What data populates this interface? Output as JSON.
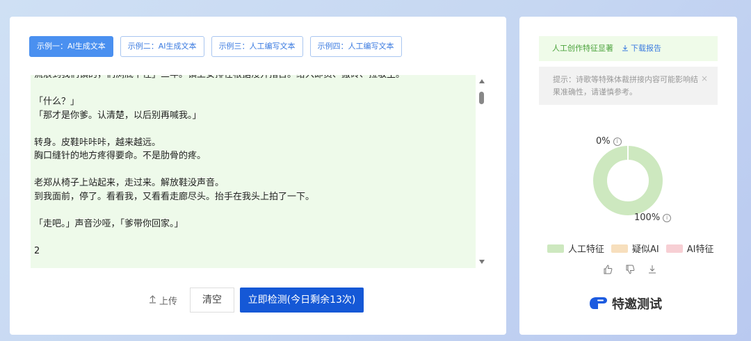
{
  "tabs": [
    {
      "label": "示例一：AI生成文本",
      "active": true
    },
    {
      "label": "示例二：AI生成文本",
      "active": false
    },
    {
      "label": "示例三：人工编写文本",
      "active": false
    },
    {
      "label": "示例四：人工编写文本",
      "active": false
    }
  ],
  "editor": {
    "lines": [
      "流浪到我们镇的，们浏底下住」三年。镇上安排在根据浸开措否。给入即员、搬砖、拉敬生。",
      "",
      "「什么？」",
      "「那才是你爹。认清楚，以后别再喊我。」",
      "",
      "转身。皮鞋咔咔咔，越来越远。",
      "胸口缝针的地方疼得要命。不是肋骨的疼。",
      "",
      "老郑从椅子上站起来，走过来。解放鞋没声音。",
      "到我面前，停了。看看我，又看看走廊尽头。抬手在我头上拍了一下。",
      "",
      "「走吧。」声音沙哑，「爹带你回家。」",
      "",
      "2"
    ]
  },
  "actions": {
    "upload_label": "上传",
    "clear_label": "清空",
    "detect_label": "立即检测(今日剩余13次)"
  },
  "result": {
    "feature_text": "人工创作特征显著",
    "download_label": "下载报告",
    "tip_text": "提示：诗歌等特殊体裁拼接内容可能影响结果准确性，请谨慎参考。",
    "close_glyph": "×"
  },
  "chart_data": {
    "type": "pie",
    "categories": [
      "人工特征",
      "疑似AI",
      "AI特征"
    ],
    "values": [
      100,
      0,
      0
    ],
    "labels": [
      "100%",
      "0%"
    ],
    "colors": [
      "#cde8bf",
      "#f7dfbd",
      "#f7cfd4"
    ]
  },
  "legend": [
    "人工特征",
    "疑似AI",
    "AI特征"
  ],
  "brand": {
    "name": "特邀测试"
  },
  "icons": {
    "upload": "upload-icon",
    "download": "download-icon",
    "thumbs_up": "thumbs-up-icon",
    "thumbs_down": "thumbs-down-icon",
    "export": "export-icon",
    "info": "info-icon",
    "brand": "brand-logo-icon"
  }
}
